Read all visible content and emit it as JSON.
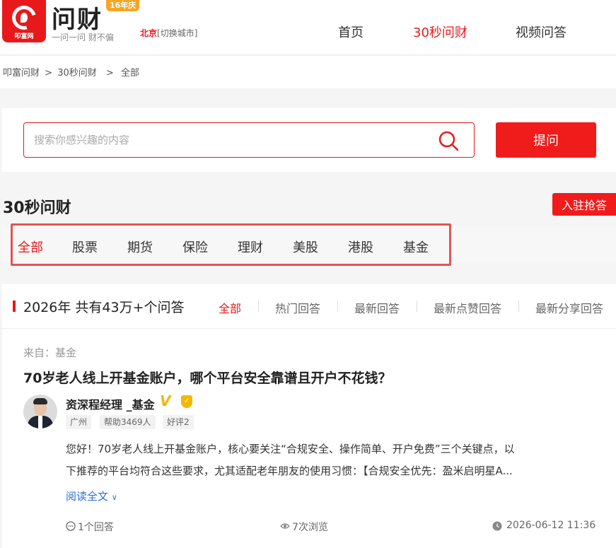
{
  "header": {
    "logo_text": "问财",
    "logo_small": "叩富网",
    "tagline": "一问一问 财不偏",
    "anniversary": "16年庆",
    "city": "北京",
    "city_switch": "[切换城市]",
    "nav": [
      "首页",
      "30秒问财",
      "视频问答"
    ]
  },
  "breadcrumb": [
    "叩富问财",
    ">",
    "30秒问财",
    ">",
    "全部"
  ],
  "search": {
    "placeholder": "搜索你感兴趣的内容",
    "ask_label": "提问"
  },
  "section": {
    "title": "30秒问财",
    "join_label": "入驻抢答"
  },
  "categories": [
    "全部",
    "股票",
    "期货",
    "保险",
    "理财",
    "美股",
    "港股",
    "基金"
  ],
  "list": {
    "stat": "2026年 共有43万+个问答",
    "sort_tabs": [
      "全部",
      "热门回答",
      "最新回答",
      "最新点赞回答",
      "最新分享回答"
    ]
  },
  "question": {
    "from": "来自：基金",
    "title": "70岁老人线上开基金账户，哪个平台安全靠谱且开户不花钱？",
    "author": "资深程经理 _基金",
    "tags": [
      "广州",
      "帮助3469人",
      "好评2"
    ],
    "answer_line1": "您好！70岁老人线上开基金账户，核心要关注“合规安全、操作简单、开户免费”三个关键点，以",
    "answer_line2": "下推荐的平台均符合这些要求，尤其适配老年朋友的使用习惯：【合规安全优先：盈米启明星A...",
    "read_more": "阅读全文",
    "answers": "1个回答",
    "views": "7次浏览",
    "time": "2026-06-12 11:36"
  },
  "colors": {
    "accent": "#e8191b",
    "link": "#2a6fd6",
    "badge": "#f5b800"
  }
}
